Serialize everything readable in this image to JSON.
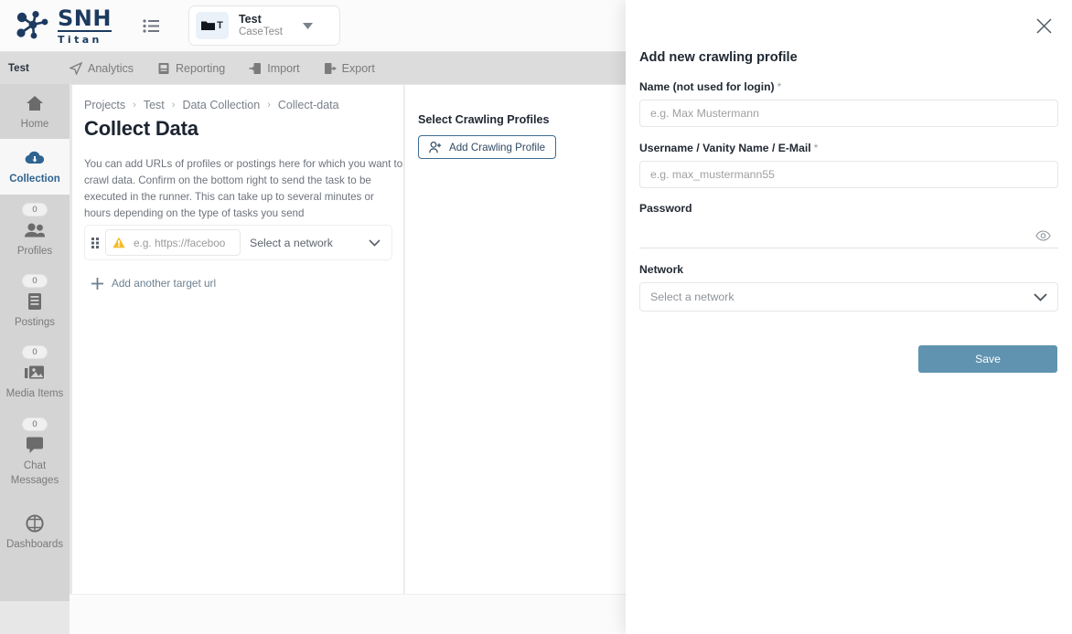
{
  "brand": {
    "name": "SNH",
    "sub": "Titan",
    "logo_icon": "molecule-nodes-logo",
    "color": "#1d3a5f"
  },
  "topbar": {
    "list_icon": "list-icon",
    "project_chip": {
      "avatar_icon": "folder-icon",
      "avatar_letter": "T",
      "title": "Test",
      "subtitle": "CaseTest",
      "caret_icon": "caret-down-icon"
    }
  },
  "subnav": {
    "project_label": "Test",
    "tabs": [
      {
        "label": "Analytics",
        "icon": "analytics-send-icon"
      },
      {
        "label": "Reporting",
        "icon": "reporting-doc-icon"
      },
      {
        "label": "Import",
        "icon": "import-arrow-icon"
      },
      {
        "label": "Export",
        "icon": "export-arrow-icon"
      }
    ]
  },
  "sidebar": {
    "items": [
      {
        "label": "Home",
        "icon": "home-icon",
        "badge": null,
        "active": false
      },
      {
        "label": "Collection",
        "icon": "cloud-download-icon",
        "badge": null,
        "active": true
      },
      {
        "label": "Profiles",
        "icon": "users-icon",
        "badge": "0",
        "active": false
      },
      {
        "label": "Postings",
        "icon": "book-icon",
        "badge": "0",
        "active": false
      },
      {
        "label": "Media Items",
        "icon": "media-image-icon",
        "badge": "0",
        "active": false
      },
      {
        "label": "Chat Messages",
        "icon": "chat-bubble-icon",
        "badge": "0",
        "active": false
      },
      {
        "label": "Dashboards",
        "icon": "dashboard-gauge-icon",
        "badge": null,
        "active": false
      }
    ],
    "active_color": "#2f6390"
  },
  "main": {
    "breadcrumb": [
      "Projects",
      "Test",
      "Data Collection",
      "Collect-data"
    ],
    "breadcrumb_separator": "›",
    "title": "Collect Data",
    "description": "You can add URLs of profiles or postings here for which you want to crawl data. Confirm on the bottom right to send the task to be executed in the runner. This can take up to several minutes or hours depending on the type of tasks you send",
    "url_row": {
      "drag_handle_icon": "drag-handle-icon",
      "warning_icon": "warning-triangle-icon",
      "url_value": "",
      "url_placeholder": "e.g. https://faceboo",
      "network_label": "Select a network",
      "network_caret_icon": "chevron-down-icon"
    },
    "add_target_url": {
      "label": "Add another target url",
      "icon": "plus-icon"
    },
    "profiles_panel": {
      "title": "Select Crawling Profiles",
      "add_button": {
        "label": "Add Crawling Profile",
        "icon": "add-person-icon"
      }
    }
  },
  "drawer": {
    "close_icon": "close-icon",
    "title": "Add new crawling profile",
    "fields": {
      "name": {
        "label": "Name (not used for login)",
        "required_mark": "*",
        "value": "",
        "placeholder": "e.g. Max Mustermann"
      },
      "username": {
        "label": "Username / Vanity Name / E-Mail",
        "required_mark": "*",
        "value": "",
        "placeholder": "e.g. max_mustermann55"
      },
      "password": {
        "label": "Password",
        "value": "",
        "placeholder": "",
        "toggle_icon": "eye-icon"
      },
      "network": {
        "label": "Network",
        "selected": "Select a network",
        "caret_icon": "chevron-down-icon"
      }
    },
    "save_button": {
      "label": "Save",
      "color": "#5f93af"
    }
  }
}
